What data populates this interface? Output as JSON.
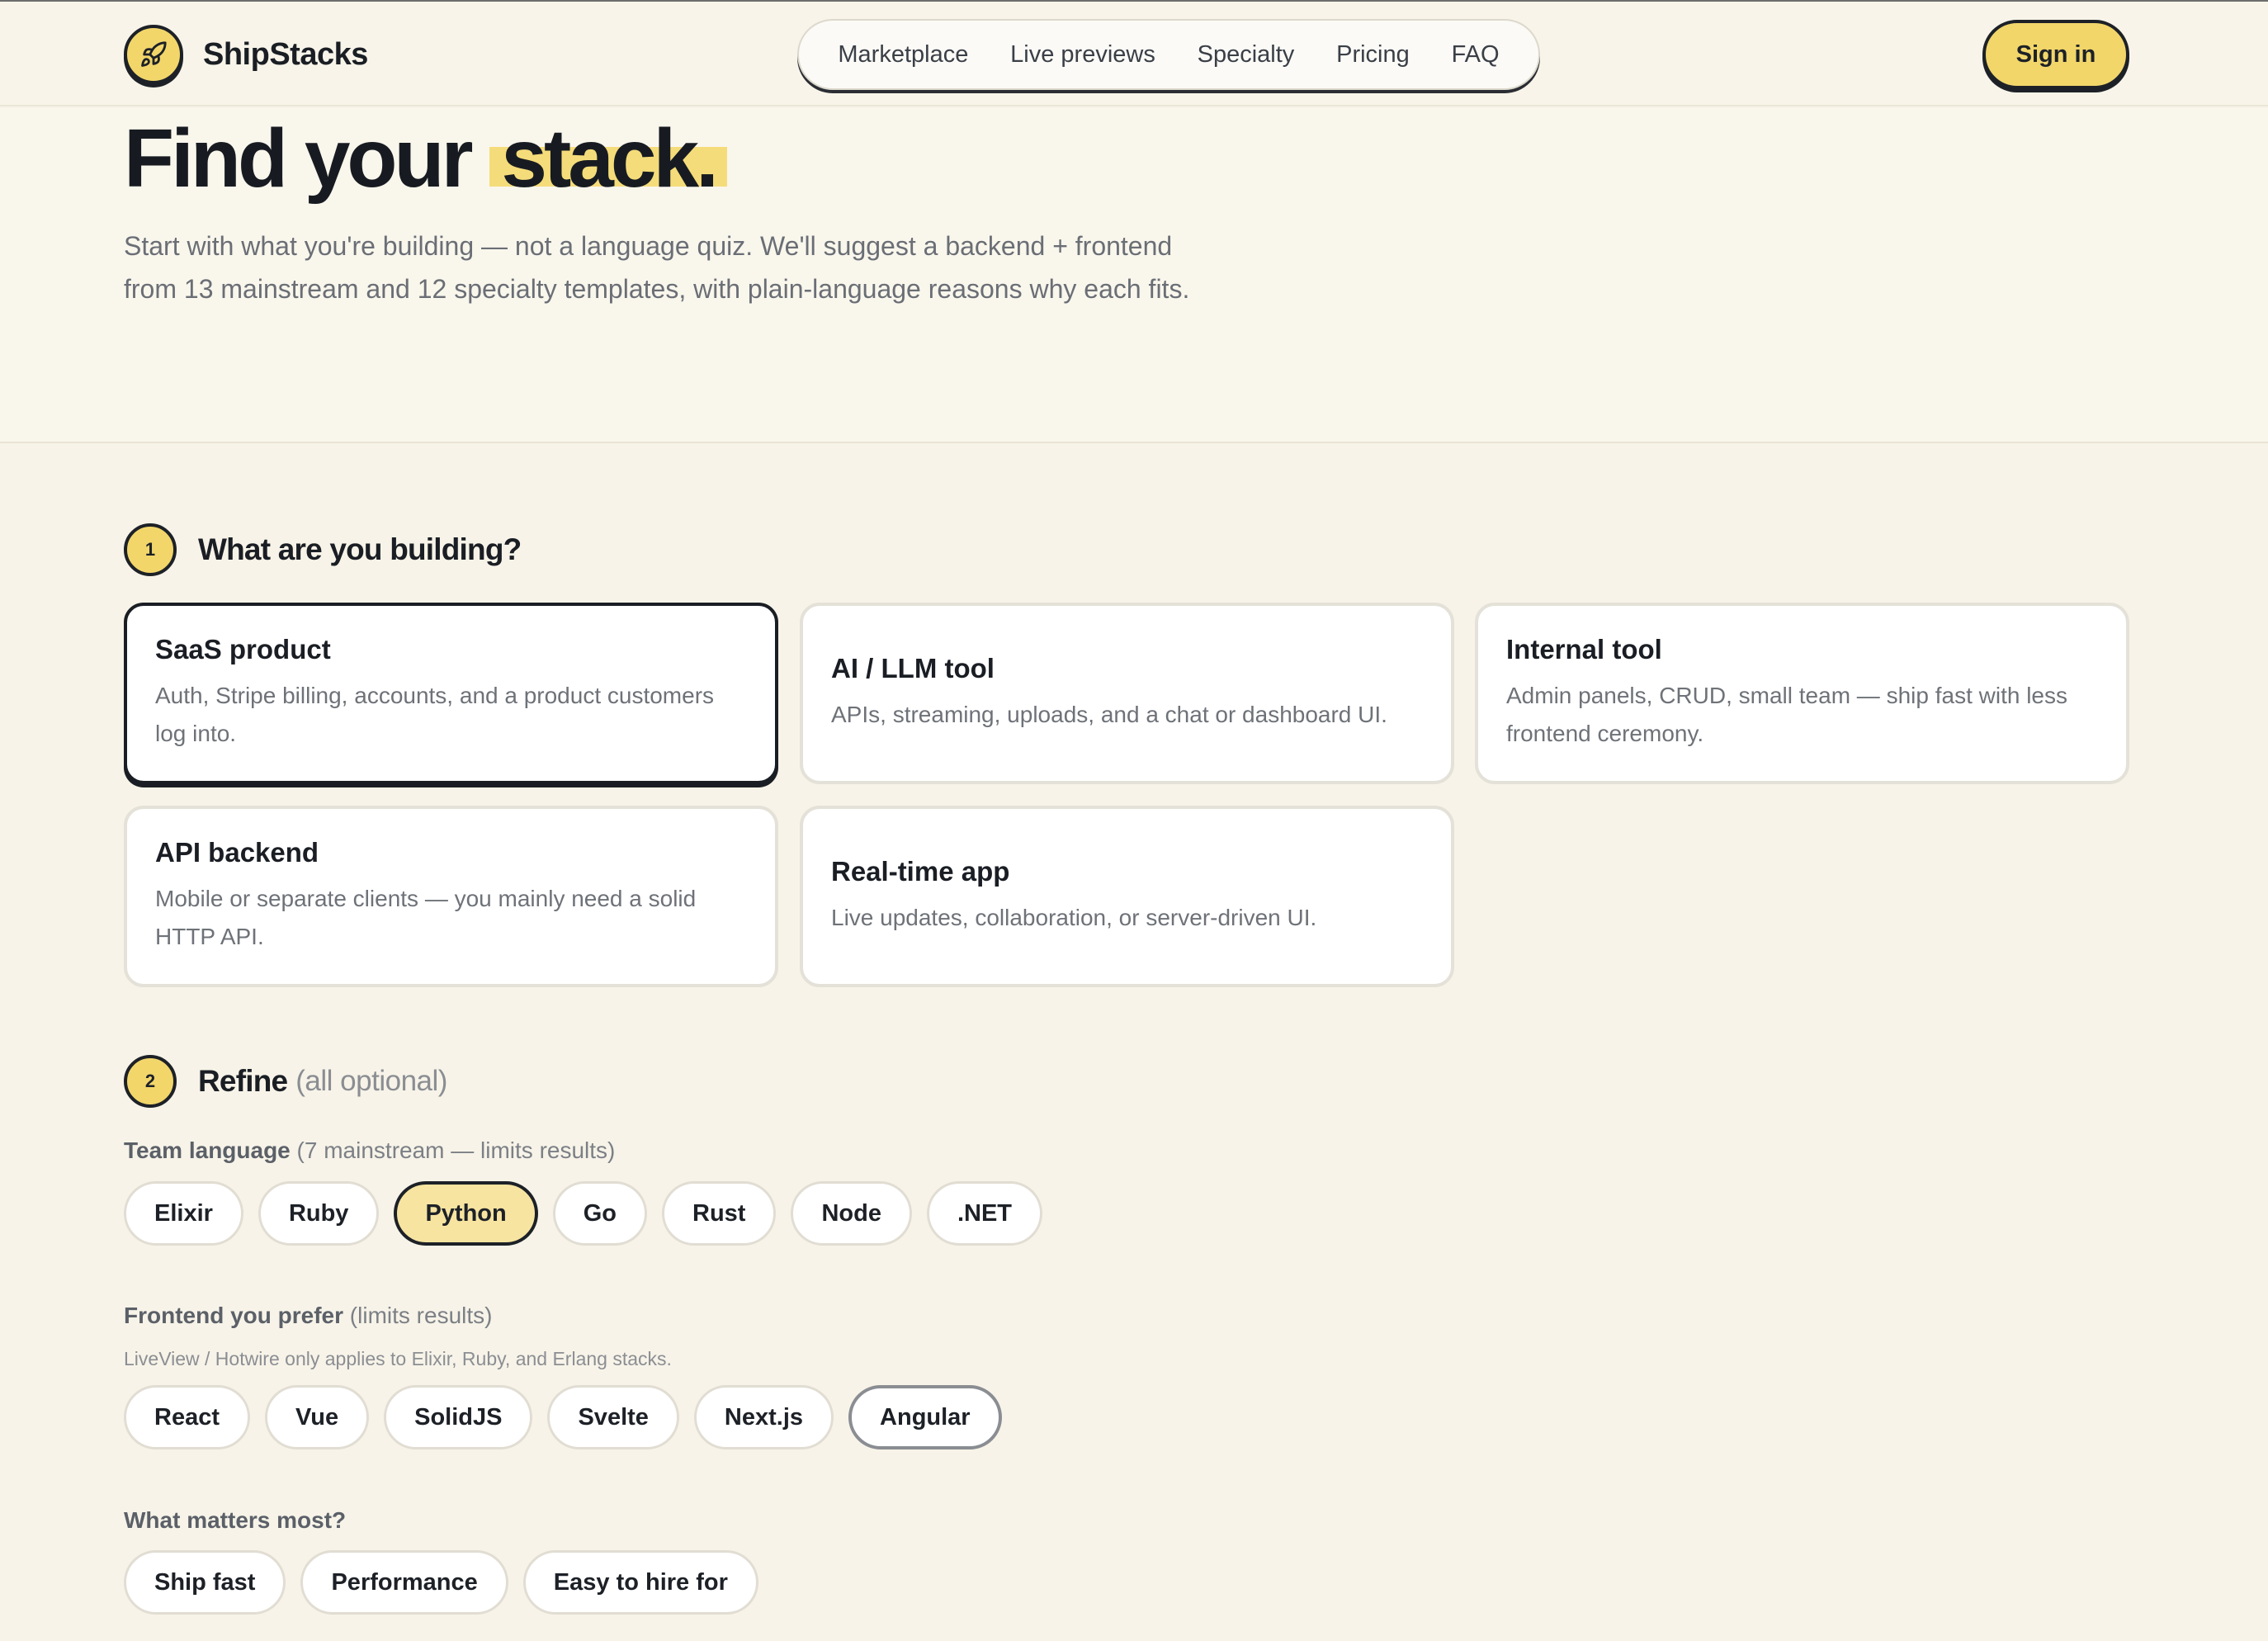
{
  "header": {
    "brand": "ShipStacks",
    "nav": [
      "Marketplace",
      "Live previews",
      "Specialty",
      "Pricing",
      "FAQ"
    ],
    "signin": "Sign in"
  },
  "hero": {
    "title_start": "Find your",
    "title_highlight": "stack.",
    "subtitle_line1": "Start with what you're building — not a language quiz. We'll suggest a backend + frontend",
    "subtitle_line2": "from 13 mainstream and 12 specialty templates, with plain-language reasons why each fits."
  },
  "step1": {
    "number": "1",
    "title": "What are you building?",
    "cards": [
      {
        "title": "SaaS product",
        "desc": "Auth, Stripe billing, accounts, and a product customers log into.",
        "selected": true
      },
      {
        "title": "AI / LLM tool",
        "desc": "APIs, streaming, uploads, and a chat or dashboard UI.",
        "selected": false
      },
      {
        "title": "Internal tool",
        "desc": "Admin panels, CRUD, small team — ship fast with less frontend ceremony.",
        "selected": false
      },
      {
        "title": "API backend",
        "desc": "Mobile or separate clients — you mainly need a solid HTTP API.",
        "selected": false
      },
      {
        "title": "Real-time app",
        "desc": "Live updates, collaboration, or server-driven UI.",
        "selected": false
      }
    ]
  },
  "step2": {
    "number": "2",
    "title": "Refine",
    "note": "(all optional)",
    "team_language": {
      "label": "Team language",
      "note": "(7 mainstream — limits results)",
      "options": [
        "Elixir",
        "Ruby",
        "Python",
        "Go",
        "Rust",
        "Node",
        ".NET"
      ],
      "selected": "Python"
    },
    "frontend": {
      "label": "Frontend you prefer",
      "note": "(limits results)",
      "hint": "LiveView / Hotwire only applies to Elixir, Ruby, and Erlang stacks.",
      "options": [
        "React",
        "Vue",
        "SolidJS",
        "Svelte",
        "Next.js",
        "Angular"
      ],
      "hovered": "Angular"
    },
    "priority": {
      "label": "What matters most?",
      "options": [
        "Ship fast",
        "Performance",
        "Easy to hire for"
      ]
    }
  }
}
